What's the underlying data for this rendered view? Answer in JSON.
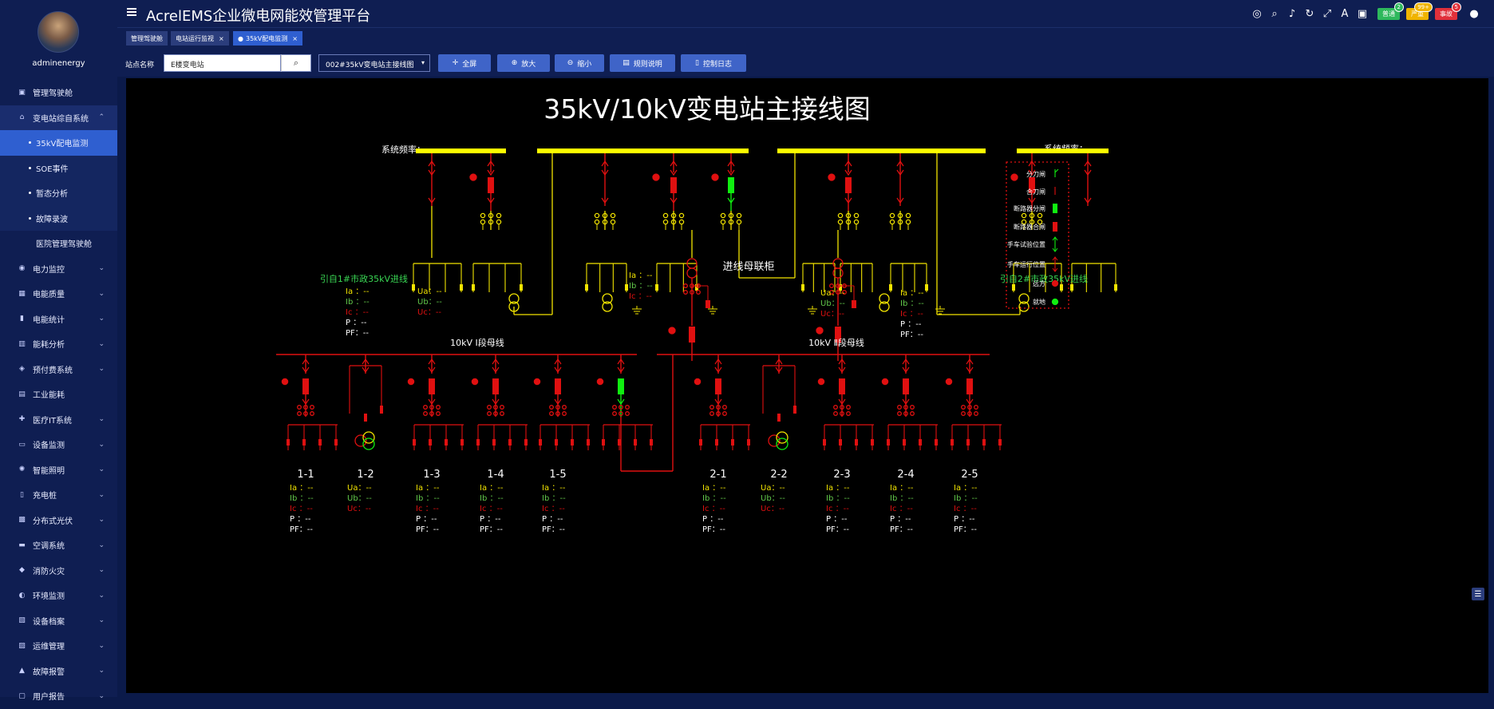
{
  "user": {
    "name": "adminenergy"
  },
  "sidebar": {
    "items": [
      {
        "label": "管理驾驶舱",
        "icon": "dashboard-icon"
      },
      {
        "label": "变电站综自系统",
        "icon": "substation-icon"
      },
      {
        "label": "35kV配电监测"
      },
      {
        "label": "SOE事件"
      },
      {
        "label": "暂态分析"
      },
      {
        "label": "故障录波"
      },
      {
        "label": "医院管理驾驶舱"
      },
      {
        "label": "电力监控",
        "icon": "power-icon"
      },
      {
        "label": "电能质量",
        "icon": "quality-icon"
      },
      {
        "label": "电能统计",
        "icon": "stats-icon"
      },
      {
        "label": "能耗分析",
        "icon": "analysis-icon"
      },
      {
        "label": "预付费系统",
        "icon": "prepay-icon"
      },
      {
        "label": "工业能耗",
        "icon": "industry-icon"
      },
      {
        "label": "医疗IT系统",
        "icon": "medical-icon"
      },
      {
        "label": "设备监测",
        "icon": "device-icon"
      },
      {
        "label": "智能照明",
        "icon": "light-icon"
      },
      {
        "label": "充电桩",
        "icon": "charger-icon"
      },
      {
        "label": "分布式光伏",
        "icon": "solar-icon"
      },
      {
        "label": "空调系统",
        "icon": "ac-icon"
      },
      {
        "label": "消防火灾",
        "icon": "fire-icon"
      },
      {
        "label": "环境监测",
        "icon": "env-icon"
      },
      {
        "label": "设备档案",
        "icon": "archive-icon"
      },
      {
        "label": "运维管理",
        "icon": "ops-icon"
      },
      {
        "label": "故障报警",
        "icon": "alarm-icon"
      },
      {
        "label": "用户报告",
        "icon": "report-icon"
      }
    ]
  },
  "header": {
    "title": "AcrelEMS企业微电网能效管理平台",
    "badges": [
      {
        "label": "普通",
        "count": "2",
        "color": "#2eb85c"
      },
      {
        "label": "严重",
        "count": "99+",
        "color": "#f0b400"
      },
      {
        "label": "事故",
        "count": "5",
        "color": "#e0303a"
      }
    ]
  },
  "tabs": [
    {
      "label": "管理驾驶舱"
    },
    {
      "label": "电站运行监视"
    },
    {
      "label": "35kV配电监测"
    }
  ],
  "toolbar": {
    "station_label": "站点名称",
    "station_value": "E楼变电站",
    "diagram_select": "002#35kV变电站主接线图",
    "buttons": [
      "全屏",
      "放大",
      "缩小",
      "规则说明",
      "控制日志"
    ]
  },
  "diagram": {
    "title": "35kV/10kV变电站主接线图",
    "freq_left": "系统频率：--",
    "freq_right": "系统频率：--",
    "incoming1": "引自1#市政35kV进线",
    "incoming2": "引自2#市政35kV进线",
    "tie_label": "进线母联柜",
    "bus1": "10kV Ⅰ段母线",
    "bus2": "10kV Ⅱ段母线",
    "feeders": [
      "1-1",
      "1-2",
      "1-3",
      "1-4",
      "1-5",
      "2-1",
      "2-2",
      "2-3",
      "2-4",
      "2-5"
    ],
    "legend": [
      "分刀闸",
      "合刀闸",
      "断路器分闸",
      "断路器合闸",
      "手车试验位置",
      "手车运行位置",
      "远方",
      "就地"
    ],
    "cur_labels": [
      "Ia ：--",
      "Ib ：--",
      "Ic ：--",
      "P ：--",
      "PF：--"
    ],
    "volt_labels": [
      "Ua：--",
      "Ub：--",
      "Uc：--"
    ],
    "colors": {
      "bus": "#ffff00",
      "live": "#e01010",
      "open": "#10ee10",
      "yellow": "#f2e400"
    }
  }
}
